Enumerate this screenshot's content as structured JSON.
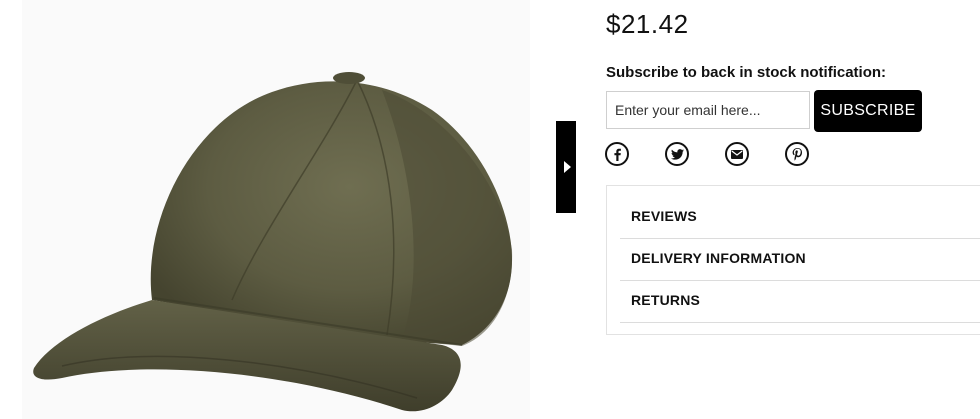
{
  "product": {
    "price": "$21.42",
    "image_alt": "Olive suede baseball cap"
  },
  "subscribe": {
    "title": "Subscribe to back in stock notification:",
    "email_placeholder": "Enter your email here...",
    "button_label": "SUBSCRIBE"
  },
  "social": {
    "icons": [
      "facebook-icon",
      "twitter-icon",
      "email-icon",
      "pinterest-icon"
    ]
  },
  "accordion": {
    "items": [
      {
        "label": "REVIEWS"
      },
      {
        "label": "DELIVERY INFORMATION"
      },
      {
        "label": "RETURNS"
      }
    ]
  },
  "colors": {
    "accent": "#000000",
    "cap_main": "#5f5e44",
    "cap_shadow": "#3f3e2c"
  }
}
